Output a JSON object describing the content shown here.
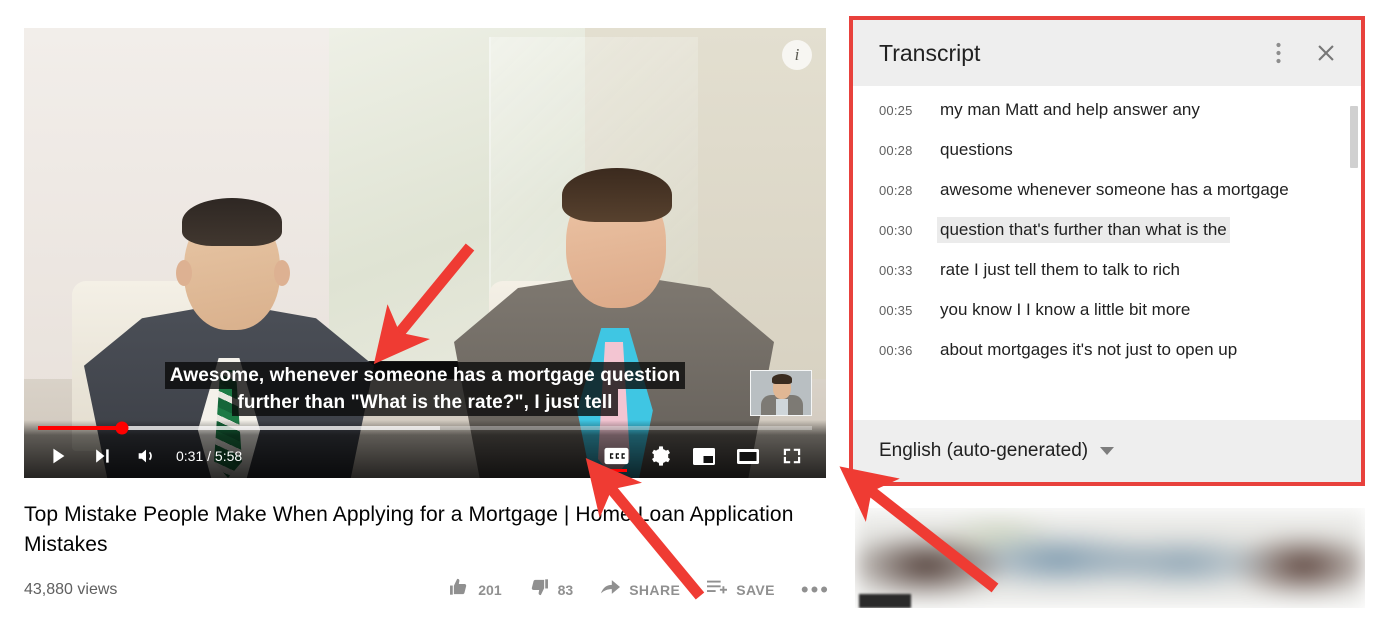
{
  "video": {
    "caption_lines": [
      "Awesome, whenever someone has a mortgage question",
      "further than \"What is the rate?\", I just tell"
    ],
    "info_badge": "i",
    "controls": {
      "play_icon": "play-icon",
      "next_icon": "next-track-icon",
      "volume_icon": "volume-icon",
      "time": "0:31 / 5:58",
      "current_time": "0:31",
      "duration": "5:58",
      "cc_icon": "closed-captions-icon",
      "settings_icon": "gear-icon",
      "miniplayer_icon": "miniplayer-icon",
      "theater_icon": "theater-mode-icon",
      "fullscreen_icon": "fullscreen-icon",
      "progress_percent": 10.9,
      "loaded_percent": 52,
      "progress_color": "#ff0000",
      "cc_active": true
    }
  },
  "meta": {
    "title": "Top Mistake People Make When Applying for a Mortgage | Home Loan Application Mistakes",
    "views": "43,880 views",
    "actions": {
      "like_count": "201",
      "dislike_count": "83",
      "share_label": "SHARE",
      "save_label": "SAVE",
      "more_label": "•••"
    }
  },
  "transcript": {
    "title": "Transcript",
    "menu_icon": "kebab-menu-icon",
    "close_icon": "close-icon",
    "active_index": 3,
    "rows": [
      {
        "time": "00:25",
        "text": "my man Matt and help answer any"
      },
      {
        "time": "00:28",
        "text": "questions"
      },
      {
        "time": "00:28",
        "text": "awesome whenever someone has a mortgage"
      },
      {
        "time": "00:30",
        "text": "question that's further than what is the"
      },
      {
        "time": "00:33",
        "text": "rate I just tell them to talk to rich"
      },
      {
        "time": "00:35",
        "text": "you know I I know a little bit more"
      },
      {
        "time": "00:36",
        "text": "about mortgages it's not just to open up"
      }
    ],
    "language": "English (auto-generated)",
    "language_caret": "chevron-down-icon"
  },
  "annotation": {
    "highlight_color": "#e8413c",
    "arrow_color": "#ef3b33",
    "arrow_count": 3
  }
}
